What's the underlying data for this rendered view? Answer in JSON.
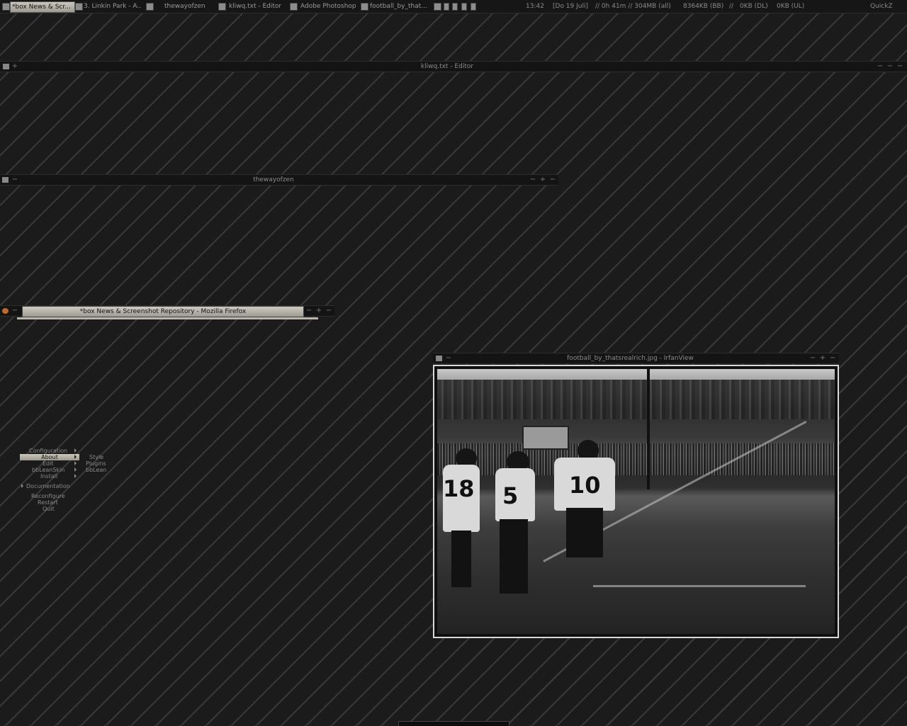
{
  "taskbar": {
    "tasks": [
      {
        "label": "*box News & Scr...",
        "active": true
      },
      {
        "label": "3. Linkin Park - A..."
      },
      {
        "label": "thewayofzen"
      },
      {
        "label": "kliwq.txt - Editor"
      },
      {
        "label": "Adobe Photoshop"
      },
      {
        "label": "football_by_that..."
      }
    ],
    "clock": "13:42",
    "date": "[Do 19 Juli]",
    "uptime": "// 0h 41m // 304MB (all)",
    "bb_mem": "8364KB (BB)",
    "sep": "//",
    "download": "0KB (DL)",
    "upload": "0KB (UL)",
    "quickz": "QuickZ"
  },
  "windows": {
    "editor": {
      "title": "kliwq.txt - Editor",
      "left_btn": "+",
      "btns": [
        "−",
        "−",
        "−"
      ]
    },
    "explorer": {
      "title": "thewayofzen",
      "left_btn": "−",
      "btns": [
        "−",
        "+",
        "−"
      ]
    },
    "firefox": {
      "title": "*box News & Screenshot Repository - Mozilla Firefox",
      "left_btn": "−",
      "btns": [
        "−",
        "+",
        "−"
      ]
    },
    "irfanview": {
      "title": "football_by_thatsrealrich.jpg - IrfanView",
      "left_btn": "−",
      "btns": [
        "−",
        "+",
        "−"
      ]
    }
  },
  "photo": {
    "numbers": [
      "18",
      "5",
      "10"
    ]
  },
  "menu": {
    "items": [
      {
        "label": "Configuration",
        "submenu": true
      },
      {
        "label": "About",
        "submenu": true,
        "selected": true
      },
      {
        "label": "Edit",
        "submenu": true
      },
      {
        "label": "bbLeanSkin",
        "submenu": true
      },
      {
        "label": "Install",
        "submenu": true
      },
      {
        "label": "Documentation"
      },
      {
        "label": "Reconfigure"
      },
      {
        "label": "Restart"
      },
      {
        "label": "Quit"
      }
    ],
    "submenu": [
      "Style",
      "Plugins",
      "bbLean"
    ]
  }
}
